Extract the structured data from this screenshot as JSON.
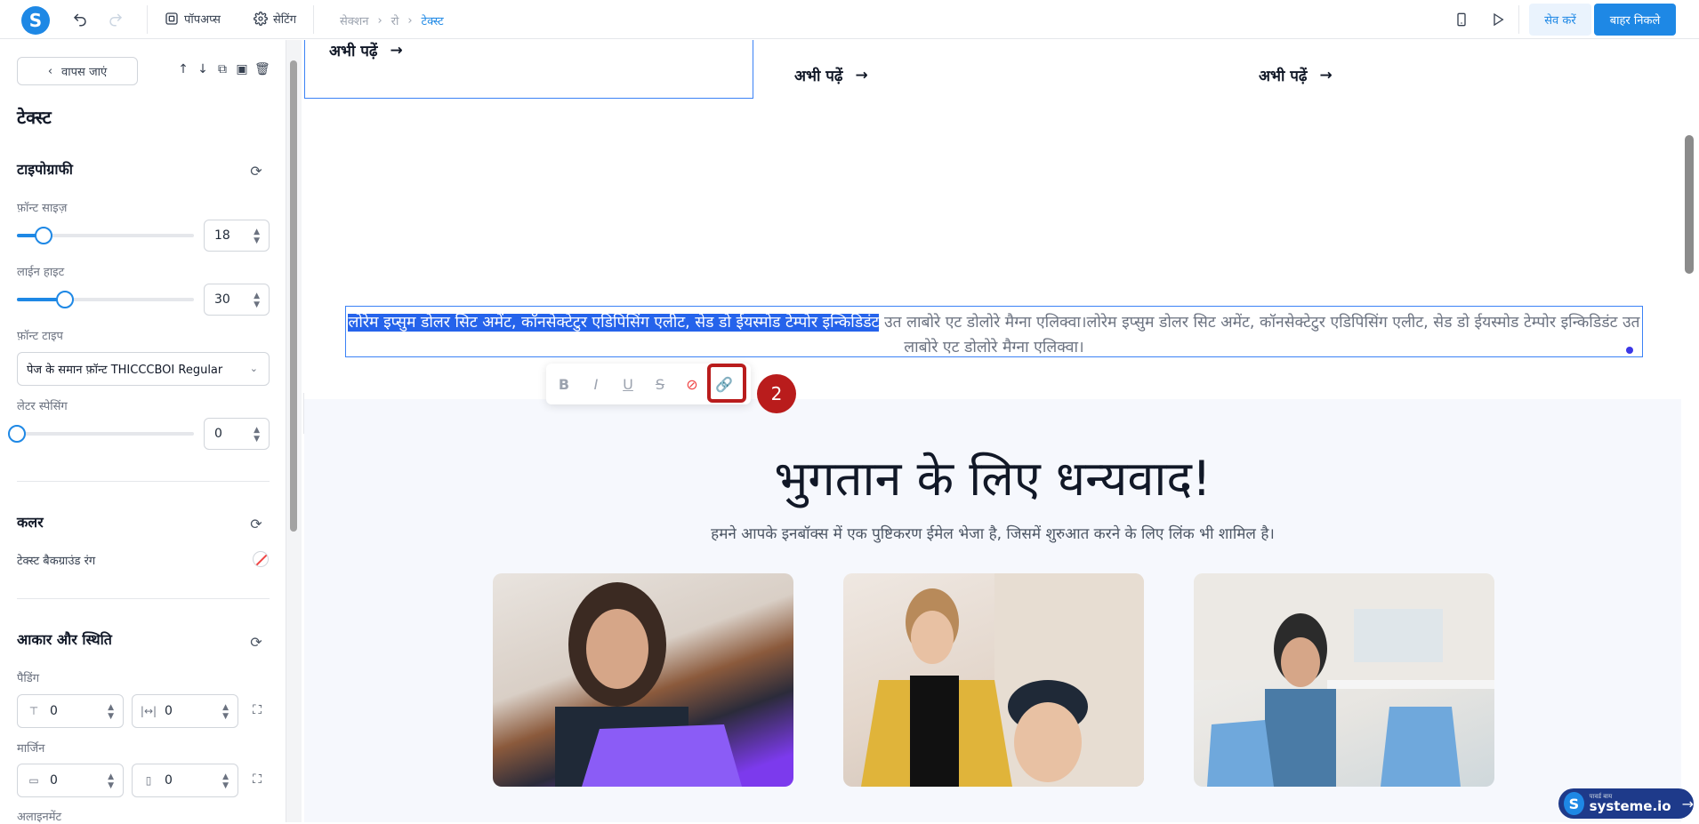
{
  "topbar": {
    "logo": "S",
    "popups_label": "पॉपअप्स",
    "settings_label": "सेटिंग",
    "breadcrumb": [
      "सेक्शन",
      "रो",
      "टेक्स्ट"
    ],
    "save_label": "सेव करें",
    "exit_label": "बाहर निकले"
  },
  "sidebar": {
    "back_label": "वापस जाएं",
    "panel_title": "टेक्स्ट",
    "typography": {
      "title": "टाइपोग्राफी",
      "font_size_label": "फ़ॉन्ट साइज़",
      "font_size_value": "18",
      "font_size_level": 0.15,
      "line_height_label": "लाईन हाइट",
      "line_height_value": "30",
      "line_height_level": 0.27,
      "font_type_label": "फ़ॉन्ट टाइप",
      "font_type_value": "पेज के समान फ़ॉन्ट THICCCBOI Regular",
      "letter_spacing_label": "लेटर स्पेसिंग",
      "letter_spacing_value": "0",
      "letter_spacing_level": 0
    },
    "color": {
      "title": "कलर",
      "text_bg_label": "टेक्स्ट बैकग्राउंड रंग"
    },
    "size_position": {
      "title": "आकार और स्थिति",
      "padding_label": "पैडिंग",
      "padding_vertical": "0",
      "padding_horizontal": "0",
      "margin_label": "मार्जिन",
      "margin_vertical": "0",
      "margin_horizontal": "0",
      "alignment_label": "अलाइनमेंट"
    }
  },
  "canvas": {
    "read_more": [
      "अभी पढ़ें",
      "अभी पढ़ें",
      "अभी पढ़ें"
    ],
    "paragraph_selected": "लोरेम इप्सुम डोलर सिट अमेंट, कॉनसेक्टेटुर एडिपिसिंग एलीट, सेड डो ईयस्मोड टेम्पोर इन्किडिडंट",
    "paragraph_rest": " उत लाबोरे एट डोलोरे मैग्ना एलिक्वा।लोरेम इप्सुम डोलर सिट अमेंट, कॉनसेक्टेटुर एडिपिसिंग एलीट, सेड डो ईयस्मोड टेम्पोर इन्किडिडंट उत लाबोरे एट डोलोरे मैग्ना एलिक्वा।",
    "step_badge": "2",
    "thanks_heading": "भुगतान के लिए धन्यवाद!",
    "thanks_sub": "हमने आपके इनबॉक्स में एक पुष्टिकरण ईमेल भेजा है, जिसमें शुरुआत करने के लिए लिंक भी शामिल है।"
  },
  "badge_systeme": {
    "small": "पावर्ड बाय",
    "brand": "systeme.io"
  },
  "colors": {
    "accent": "#1e88e5",
    "selection": "#2563eb",
    "highlight_red": "#b91c1c"
  }
}
